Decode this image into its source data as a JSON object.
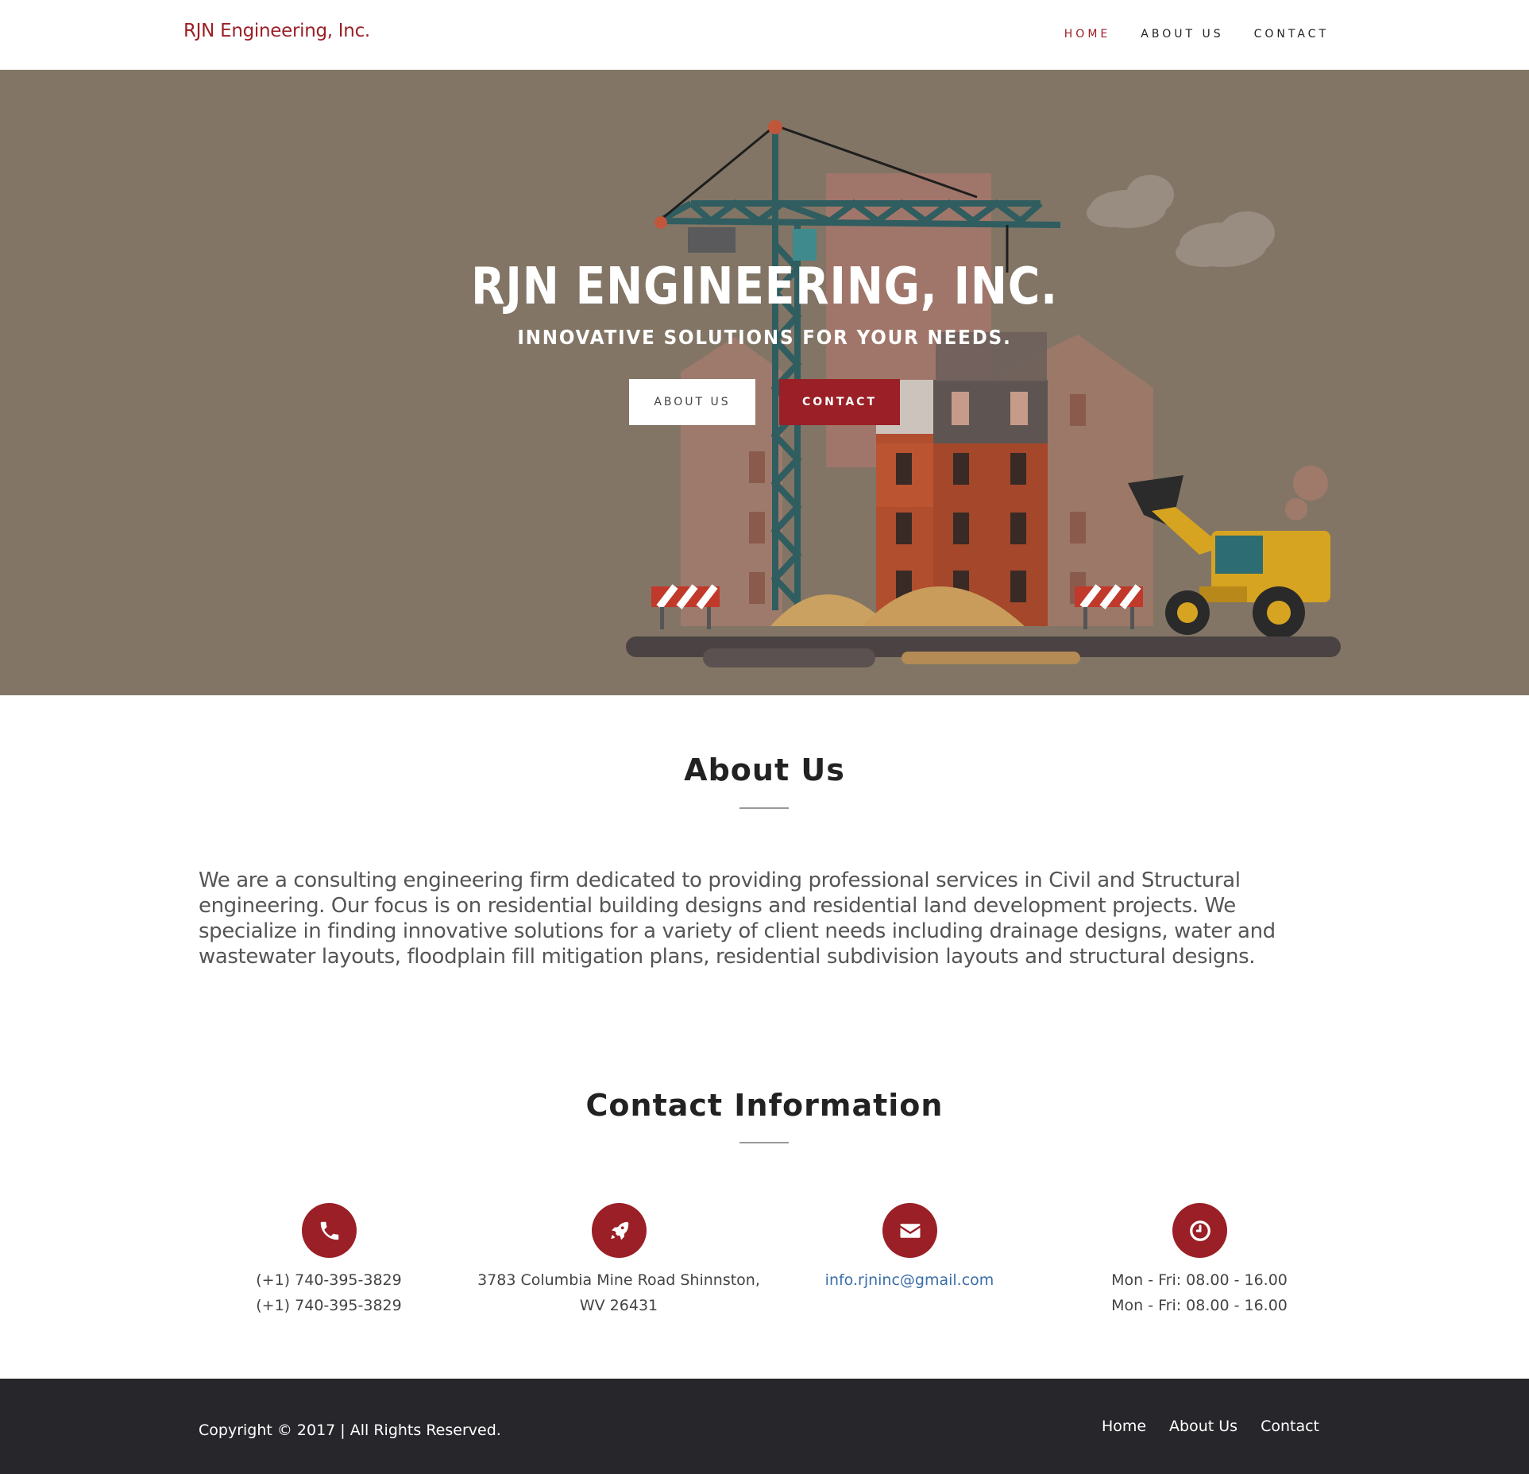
{
  "navbar": {
    "brand": "RJN Engineering, Inc.",
    "links": [
      {
        "label": "HOME",
        "active": true
      },
      {
        "label": "ABOUT US",
        "active": false
      },
      {
        "label": "CONTACT",
        "active": false
      }
    ]
  },
  "hero": {
    "title": "RJN ENGINEERING, INC.",
    "subtitle": "INNOVATIVE SOLUTIONS FOR YOUR NEEDS.",
    "about_button": "ABOUT US",
    "contact_button": "CONTACT"
  },
  "about": {
    "title": "About Us",
    "text": "We are a consulting engineering firm dedicated to providing professional services in Civil and Structural engineering. Our focus is on residential building designs and residential land development projects. We specialize in finding innovative solutions for a variety of client needs including drainage designs, water and wastewater layouts, floodplain fill mitigation plans, residential subdivision layouts and structural designs."
  },
  "contact": {
    "title": "Contact Information",
    "items": [
      {
        "icon": "phone-icon",
        "lines": [
          "(+1) 740-395-3829",
          "(+1) 740-395-3829"
        ]
      },
      {
        "icon": "rocket-icon",
        "lines": [
          "3783 Columbia Mine Road Shinnston,",
          "WV 26431"
        ]
      },
      {
        "icon": "envelope-icon",
        "lines": [
          "info.rjninc@gmail.com"
        ]
      },
      {
        "icon": "clock-icon",
        "lines": [
          "Mon - Fri: 08.00 - 16.00",
          "Mon - Fri: 08.00 - 16.00"
        ]
      }
    ]
  },
  "footer": {
    "copyright": "Copyright © 2017 | All Rights Reserved.",
    "links": [
      "Home",
      "About Us",
      "Contact"
    ]
  },
  "colors": {
    "brand": "#9a1f26",
    "hero_bg": "#827565",
    "footer_bg": "#27262b",
    "link": "#3a6ea8"
  }
}
